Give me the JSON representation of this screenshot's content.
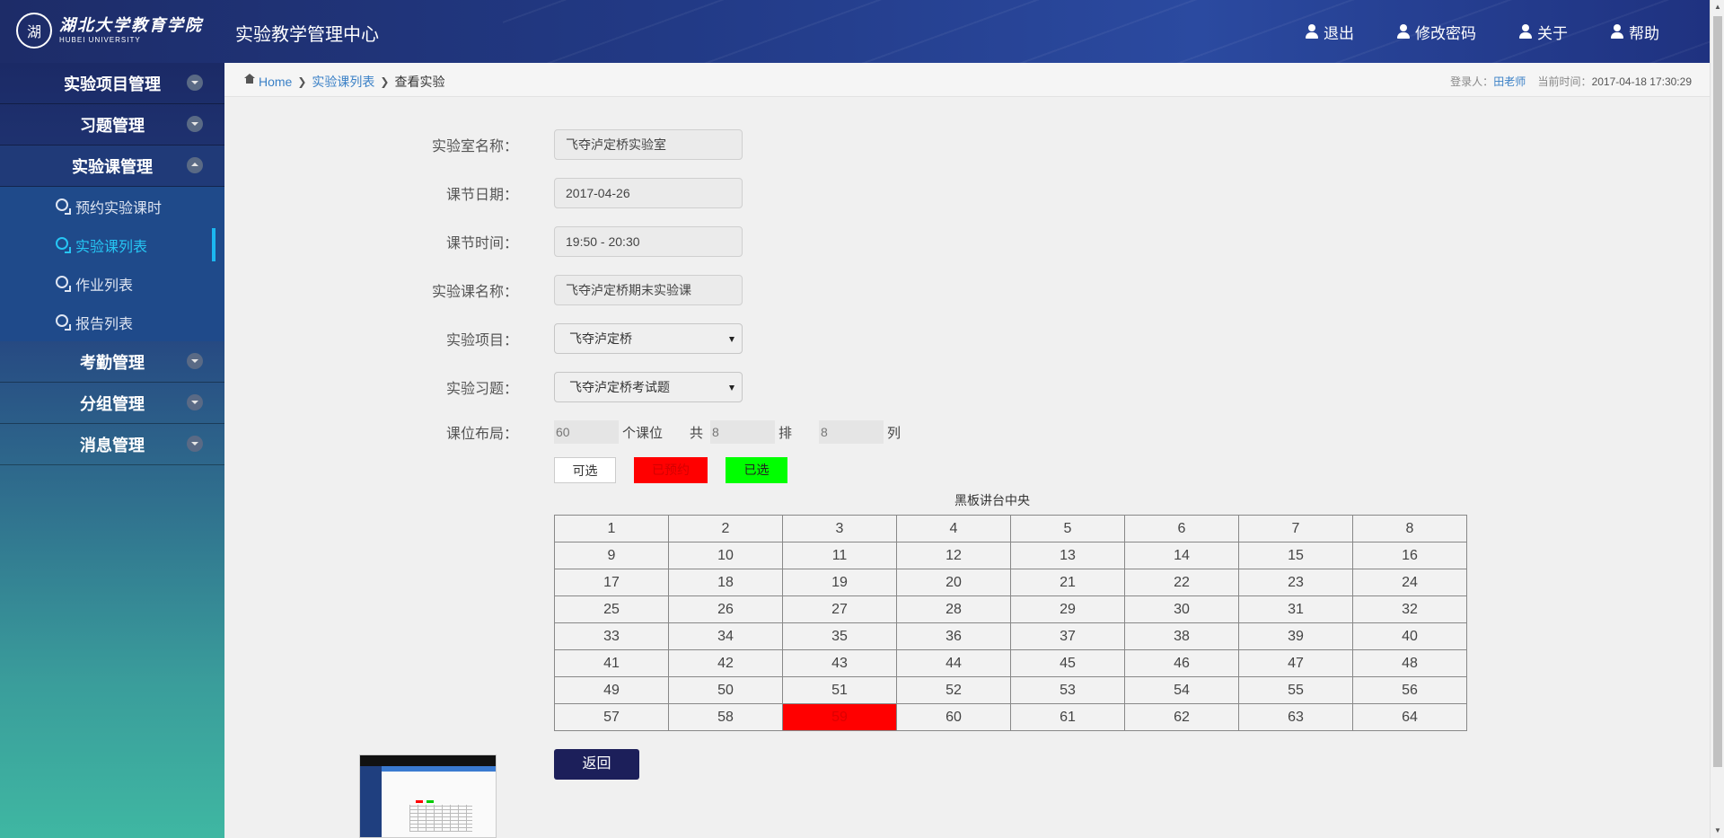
{
  "header": {
    "logo_seal": "湖",
    "logo_cn": "湖北大学教育学院",
    "logo_en": "HUBEI UNIVERSITY",
    "app_title": "实验教学管理中心",
    "nav": [
      {
        "label": "退出",
        "icon": "user-icon"
      },
      {
        "label": "修改密码",
        "icon": "user-icon"
      },
      {
        "label": "关于",
        "icon": "user-icon"
      },
      {
        "label": "帮助",
        "icon": "user-icon"
      }
    ]
  },
  "sidebar": {
    "menus": [
      {
        "label": "实验项目管理"
      },
      {
        "label": "习题管理"
      },
      {
        "label": "实验课管理",
        "expanded": true
      },
      {
        "label": "考勤管理"
      },
      {
        "label": "分组管理"
      },
      {
        "label": "消息管理"
      }
    ],
    "submenu": [
      {
        "label": "预约实验课时"
      },
      {
        "label": "实验课列表",
        "active": true
      },
      {
        "label": "作业列表"
      },
      {
        "label": "报告列表"
      }
    ]
  },
  "breadcrumb": {
    "home": "Home",
    "list": "实验课列表",
    "current": "查看实验"
  },
  "login": {
    "user_label": "登录人：",
    "user": "田老师",
    "time_label": "当前时间：",
    "time": "2017-04-18 17:30:29"
  },
  "form": {
    "lab_name_label": "实验室名称：",
    "lab_name": "飞夺泸定桥实验室",
    "date_label": "课节日期：",
    "date": "2017-04-26",
    "time_label": "课节时间：",
    "time": "19:50 - 20:30",
    "course_label": "实验课名称：",
    "course": "飞夺泸定桥期末实验课",
    "project_label": "实验项目：",
    "project": "飞夺泸定桥",
    "exercise_label": "实验习题：",
    "exercise": "飞夺泸定桥考试题",
    "layout_label": "课位布局：",
    "seats": "60",
    "seats_unit": "个课位",
    "total_label": "共",
    "rows": "8",
    "rows_unit": "排",
    "cols": "8",
    "cols_unit": "列"
  },
  "legend": {
    "available": "可选",
    "reserved": "已预约",
    "selected": "已选",
    "colors": {
      "available": "#ffffff",
      "reserved": "#ff0000",
      "selected": "#00ff00"
    }
  },
  "blackboard": "黑板讲台中央",
  "seat_rows": [
    [
      "1",
      "2",
      "3",
      "4",
      "5",
      "6",
      "7",
      "8"
    ],
    [
      "9",
      "10",
      "11",
      "12",
      "13",
      "14",
      "15",
      "16"
    ],
    [
      "17",
      "18",
      "19",
      "20",
      "21",
      "22",
      "23",
      "24"
    ],
    [
      "25",
      "26",
      "27",
      "28",
      "29",
      "30",
      "31",
      "32"
    ],
    [
      "33",
      "34",
      "35",
      "36",
      "37",
      "38",
      "39",
      "40"
    ],
    [
      "41",
      "42",
      "43",
      "44",
      "45",
      "46",
      "47",
      "48"
    ],
    [
      "49",
      "50",
      "51",
      "52",
      "53",
      "54",
      "55",
      "56"
    ],
    [
      "57",
      "58",
      "59",
      "60",
      "61",
      "62",
      "63",
      "64"
    ]
  ],
  "taken_seats": [
    "59"
  ],
  "back_button": "返回"
}
